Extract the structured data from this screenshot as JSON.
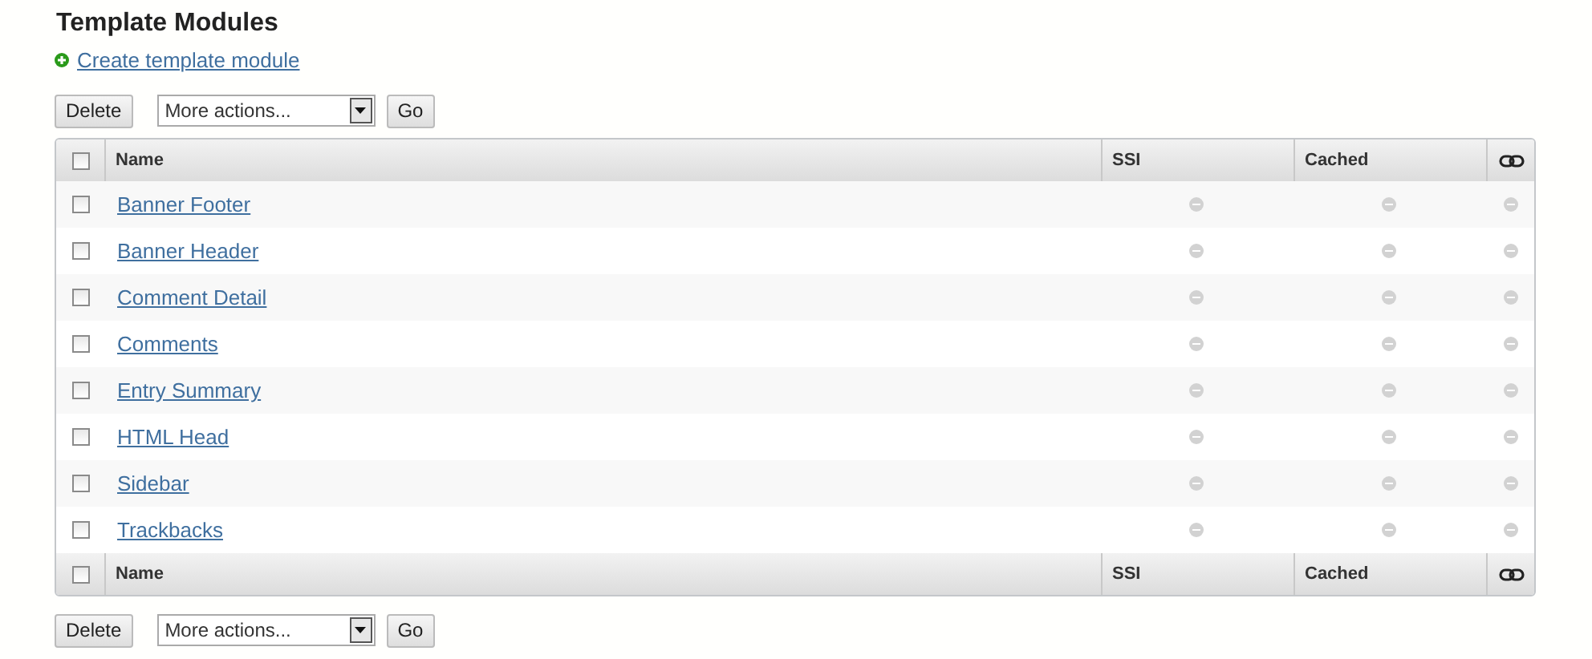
{
  "title": "Template Modules",
  "create_link": "Create template module",
  "top_actions": {
    "delete": "Delete",
    "select": "More actions...",
    "go": "Go"
  },
  "table": {
    "header": {
      "checked": false,
      "columns": [
        "Name",
        "SSI",
        "Cached"
      ]
    },
    "rows": [
      {
        "name": "Banner Footer",
        "checked": false,
        "ssi": false,
        "cached": false,
        "linked": false
      },
      {
        "name": "Banner Header",
        "checked": false,
        "ssi": false,
        "cached": false,
        "linked": false
      },
      {
        "name": "Comment Detail",
        "checked": false,
        "ssi": false,
        "cached": false,
        "linked": false
      },
      {
        "name": "Comments",
        "checked": false,
        "ssi": false,
        "cached": false,
        "linked": false
      },
      {
        "name": "Entry Summary",
        "checked": false,
        "ssi": false,
        "cached": false,
        "linked": false
      },
      {
        "name": "HTML Head",
        "checked": false,
        "ssi": false,
        "cached": false,
        "linked": false
      },
      {
        "name": "Sidebar",
        "checked": false,
        "ssi": false,
        "cached": false,
        "linked": false
      },
      {
        "name": "Trackbacks",
        "checked": false,
        "ssi": false,
        "cached": false,
        "linked": false
      }
    ],
    "footer": {
      "checked": false,
      "columns": [
        "Name",
        "SSI",
        "Cached"
      ]
    }
  },
  "bottom_actions": {
    "delete": "Delete",
    "select": "More actions...",
    "go": "Go"
  }
}
